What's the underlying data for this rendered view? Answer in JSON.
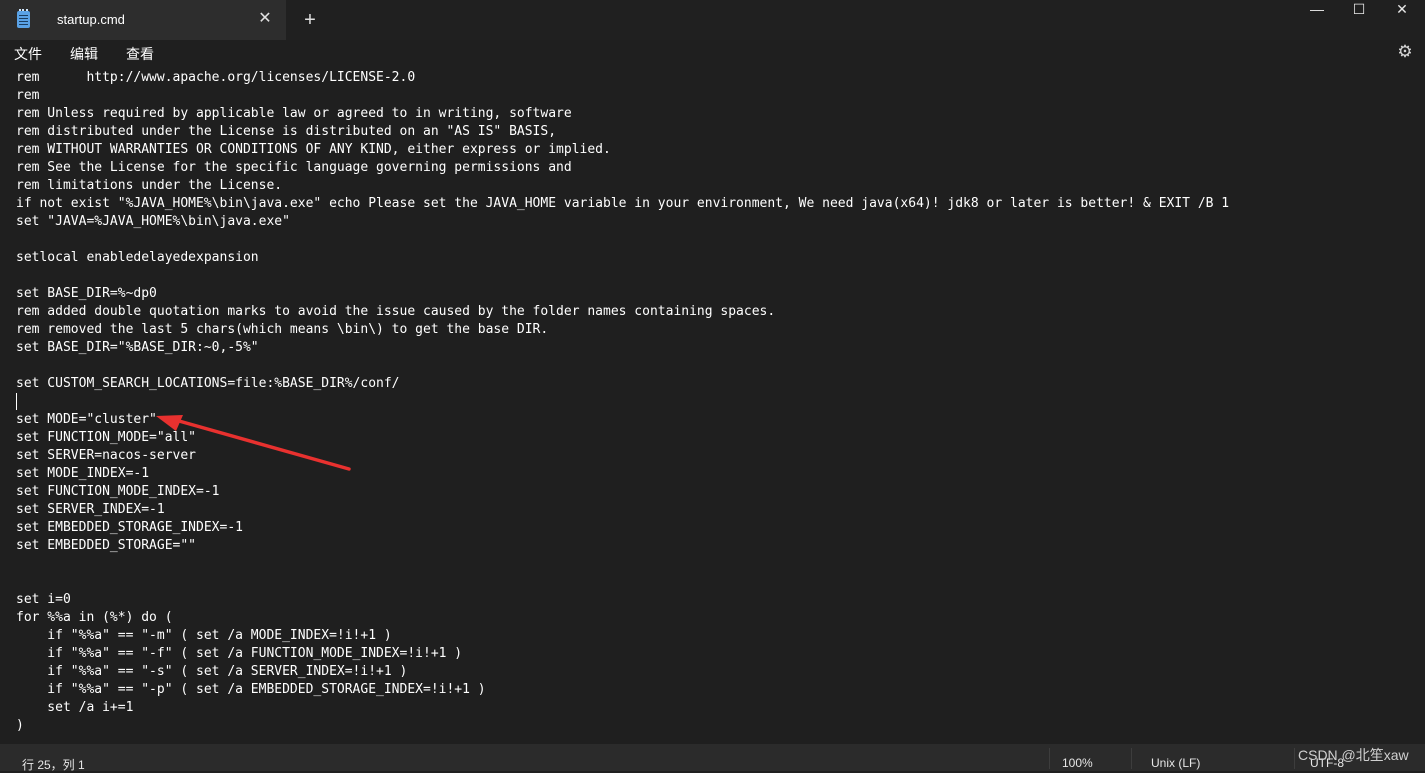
{
  "tab": {
    "title": "startup.cmd",
    "close_glyph": "✕",
    "new_glyph": "+"
  },
  "window_controls": {
    "minimize": "—",
    "maximize": "☐",
    "close": "✕"
  },
  "menu": {
    "items": [
      "文件",
      "编辑",
      "查看"
    ]
  },
  "editor": {
    "lines": [
      "rem      http://www.apache.org/licenses/LICENSE-2.0",
      "rem",
      "rem Unless required by applicable law or agreed to in writing, software",
      "rem distributed under the License is distributed on an \"AS IS\" BASIS,",
      "rem WITHOUT WARRANTIES OR CONDITIONS OF ANY KIND, either express or implied.",
      "rem See the License for the specific language governing permissions and",
      "rem limitations under the License.",
      "if not exist \"%JAVA_HOME%\\bin\\java.exe\" echo Please set the JAVA_HOME variable in your environment, We need java(x64)! jdk8 or later is better! & EXIT /B 1",
      "set \"JAVA=%JAVA_HOME%\\bin\\java.exe\"",
      "",
      "setlocal enabledelayedexpansion",
      "",
      "set BASE_DIR=%~dp0",
      "rem added double quotation marks to avoid the issue caused by the folder names containing spaces.",
      "rem removed the last 5 chars(which means \\bin\\) to get the base DIR.",
      "set BASE_DIR=\"%BASE_DIR:~0,-5%\"",
      "",
      "set CUSTOM_SEARCH_LOCATIONS=file:%BASE_DIR%/conf/",
      "",
      "set MODE=\"cluster\"",
      "set FUNCTION_MODE=\"all\"",
      "set SERVER=nacos-server",
      "set MODE_INDEX=-1",
      "set FUNCTION_MODE_INDEX=-1",
      "set SERVER_INDEX=-1",
      "set EMBEDDED_STORAGE_INDEX=-1",
      "set EMBEDDED_STORAGE=\"\"",
      "",
      "",
      "set i=0",
      "for %%a in (%*) do (",
      "    if \"%%a\" == \"-m\" ( set /a MODE_INDEX=!i!+1 )",
      "    if \"%%a\" == \"-f\" ( set /a FUNCTION_MODE_INDEX=!i!+1 )",
      "    if \"%%a\" == \"-s\" ( set /a SERVER_INDEX=!i!+1 )",
      "    if \"%%a\" == \"-p\" ( set /a EMBEDDED_STORAGE_INDEX=!i!+1 )",
      "    set /a i+=1",
      ")"
    ]
  },
  "status": {
    "position": "行 25，列 1",
    "zoom": "100%",
    "line_ending": "Unix (LF)",
    "encoding": "UTF-8"
  },
  "watermark": "CSDN @北笙xaw",
  "colors": {
    "annotation_arrow": "#e8312f",
    "background": "#1f1f1f"
  },
  "icons": {
    "app": "notepad-icon",
    "settings": "gear-icon"
  }
}
